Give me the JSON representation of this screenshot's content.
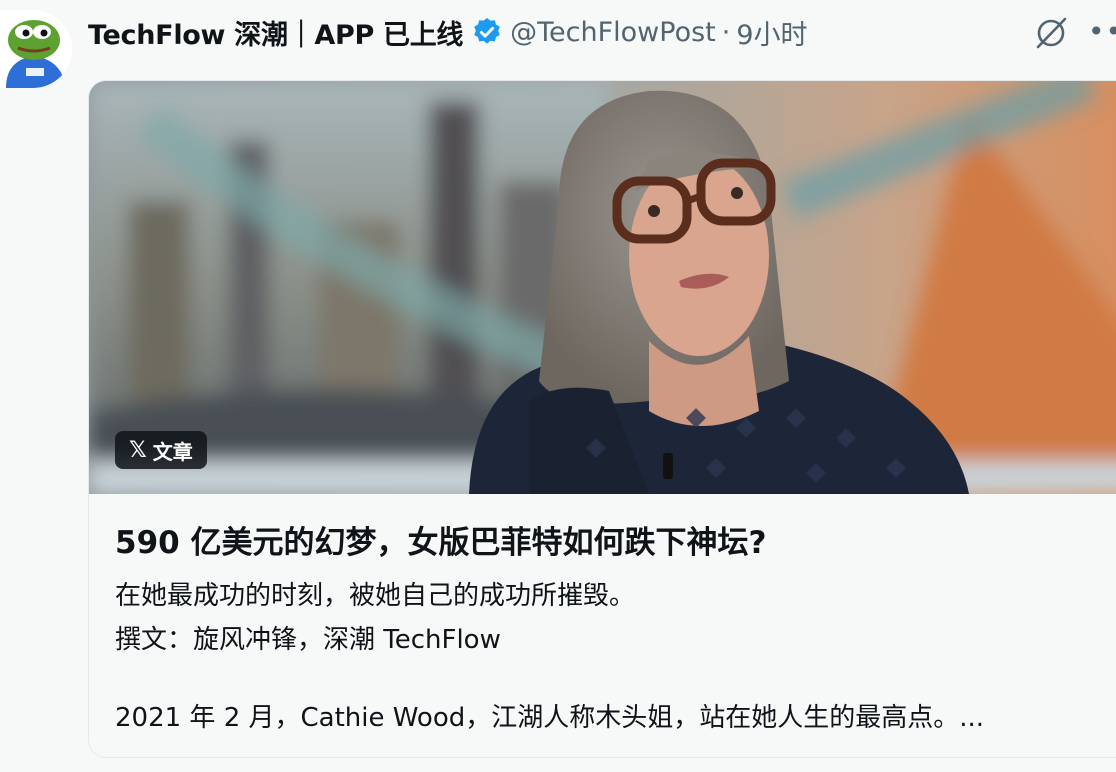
{
  "author": {
    "display_name": "TechFlow 深潮｜APP 已上线",
    "handle": "@TechFlowPost",
    "separator": "·",
    "time": "9小时",
    "verified": true
  },
  "icons": {
    "verified": "verified-badge-icon",
    "grok": "grok-icon",
    "more": "more-icon",
    "x": "x-logo-icon"
  },
  "article": {
    "badge_x": "𝕏",
    "badge_label": "文章",
    "title": "590 亿美元的幻梦，女版巴菲特如何跌下神坛?",
    "subtitle": "在她最成功的时刻，被她自己的成功所摧毁。",
    "byline": "撰文：旋风冲锋，深潮 TechFlow",
    "excerpt": "2021 年 2 月，Cathie Wood，江湖人称木头姐，站在她人生的最高点。..."
  },
  "colors": {
    "verified_blue": "#1d9bf0",
    "secondary_text": "#536471",
    "badge_bg": "#0f1419"
  }
}
